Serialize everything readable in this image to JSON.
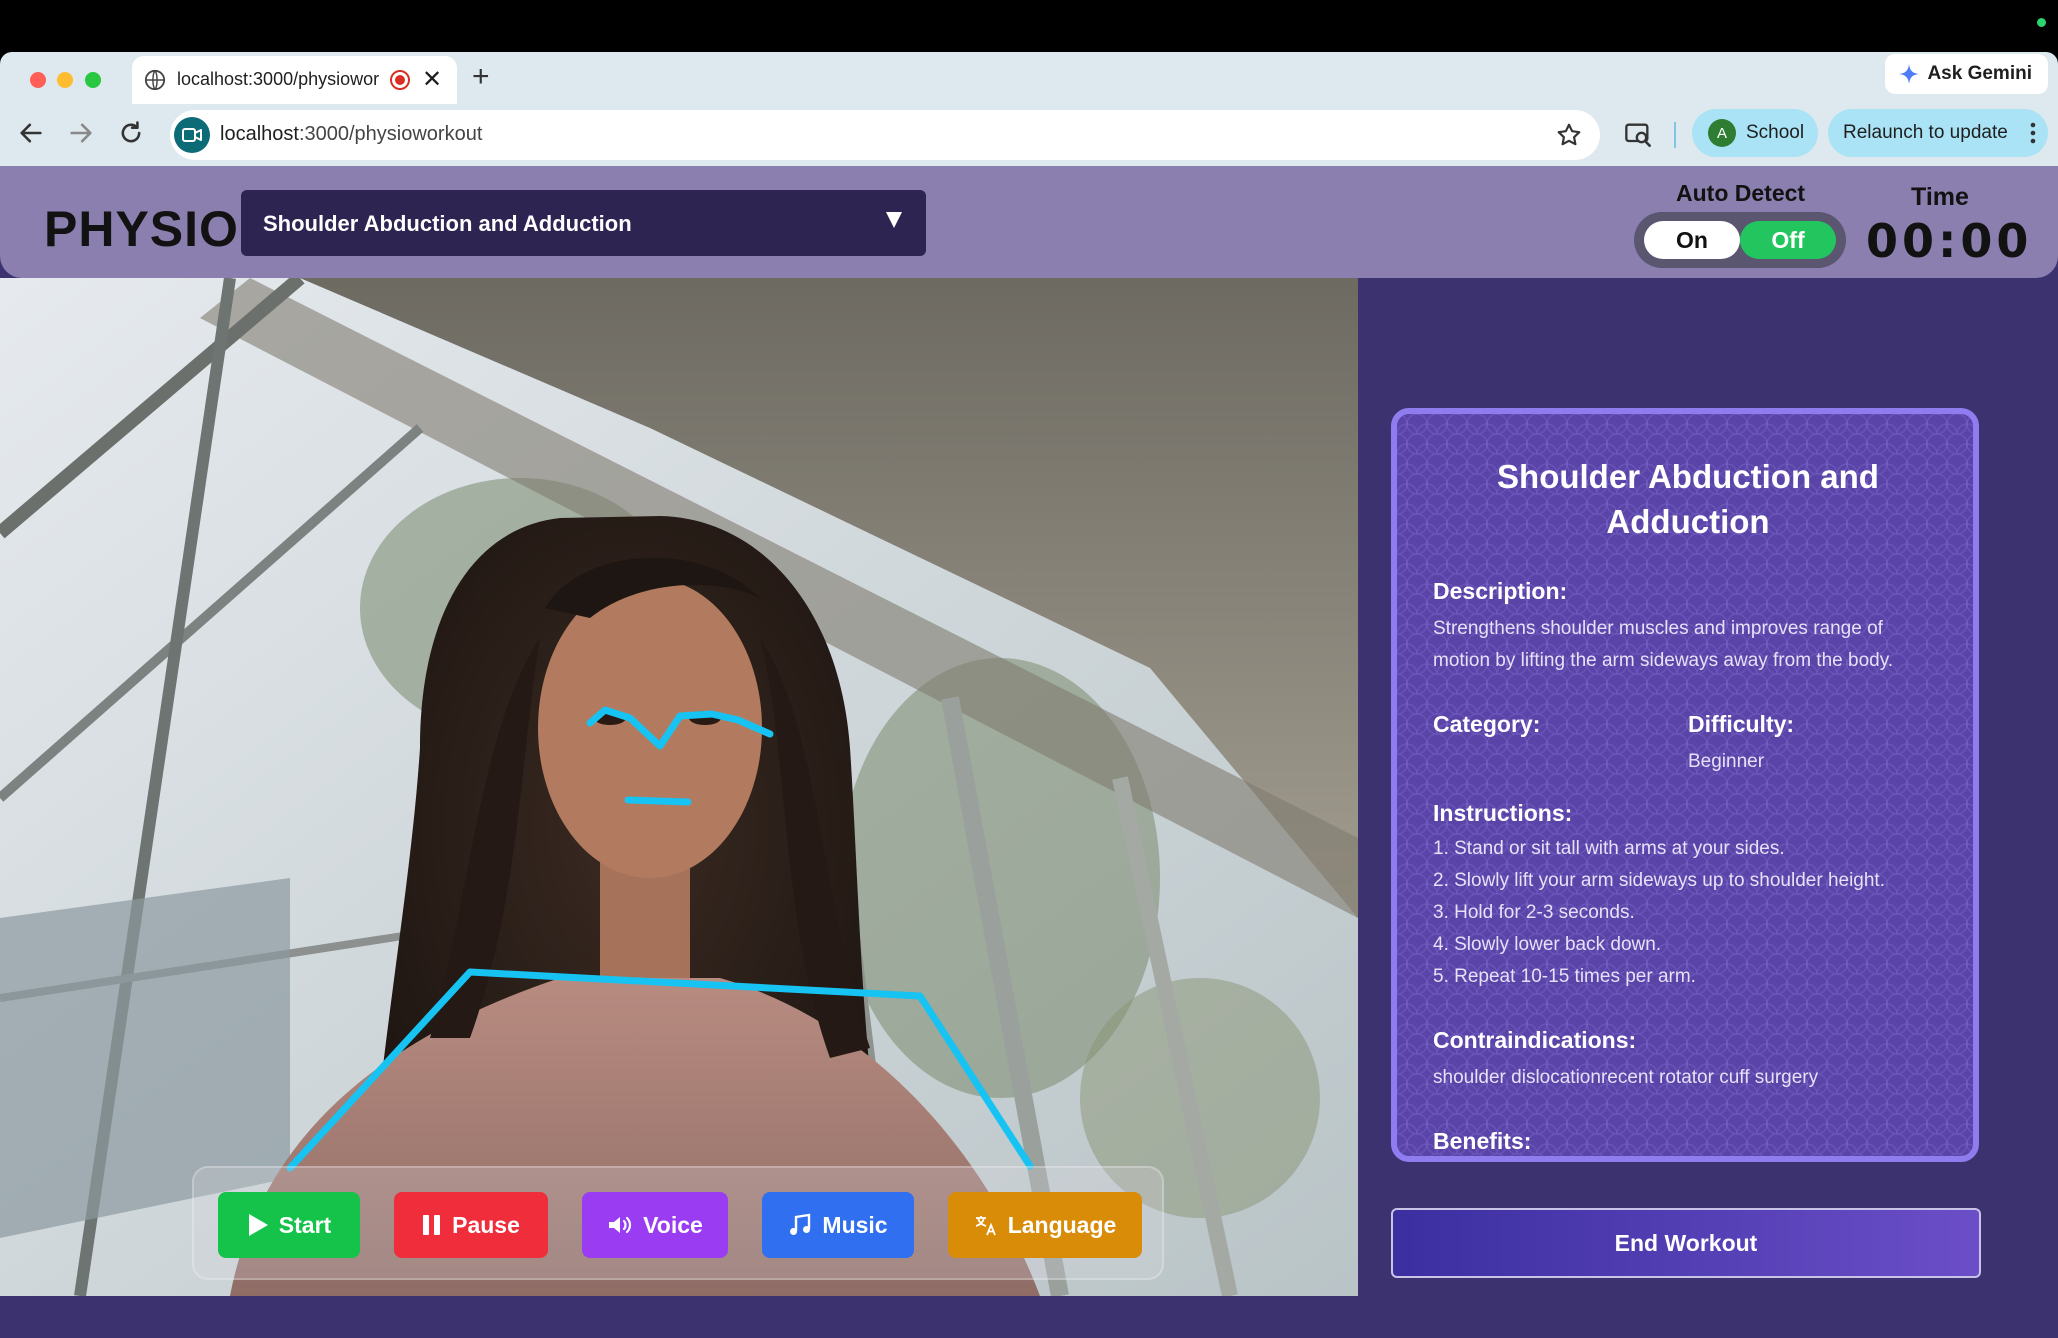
{
  "browser": {
    "tab_title": "localhost:3000/physiowor",
    "new_tab_symbol": "+",
    "close_symbol": "✕",
    "ask_gemini": "Ask Gemini",
    "url_host": "localhost",
    "url_path": ":3000/physioworkout",
    "profile_initial": "A",
    "profile_name": "School",
    "relaunch": "Relaunch to update"
  },
  "app": {
    "logo": "PHYSIO",
    "selected_exercise": "Shoulder Abduction and Adduction",
    "auto_detect": {
      "label": "Auto Detect",
      "on": "On",
      "off": "Off",
      "state": "Off"
    },
    "time": {
      "label": "Time",
      "value": "00:00"
    },
    "controls": {
      "start": "Start",
      "pause": "Pause",
      "voice": "Voice",
      "music": "Music",
      "language": "Language"
    },
    "card": {
      "title": "Shoulder Abduction and Adduction",
      "description_label": "Description:",
      "description": "Strengthens shoulder muscles and improves range of motion by lifting the arm sideways away from the body.",
      "category_label": "Category:",
      "category": "",
      "difficulty_label": "Difficulty:",
      "difficulty": "Beginner",
      "instructions_label": "Instructions:",
      "instructions": [
        "1. Stand or sit tall with arms at your sides.",
        "2. Slowly lift your arm sideways up to shoulder height.",
        "3. Hold for 2-3 seconds.",
        "4. Slowly lower back down.",
        "5. Repeat 10-15 times per arm."
      ],
      "contraindications_label": "Contraindications:",
      "contraindications": "shoulder dislocationrecent rotator cuff surgery",
      "benefits_label": "Benefits:"
    },
    "end_workout": "End Workout"
  },
  "colors": {
    "header_bg": "#8a7fae",
    "app_bg": "#3d3270",
    "pose_line": "#17c3f2",
    "start": "#16c34a",
    "pause": "#ef2d3b",
    "voice": "#9a3cf2",
    "music": "#2f6ff0",
    "language": "#d98c08"
  }
}
